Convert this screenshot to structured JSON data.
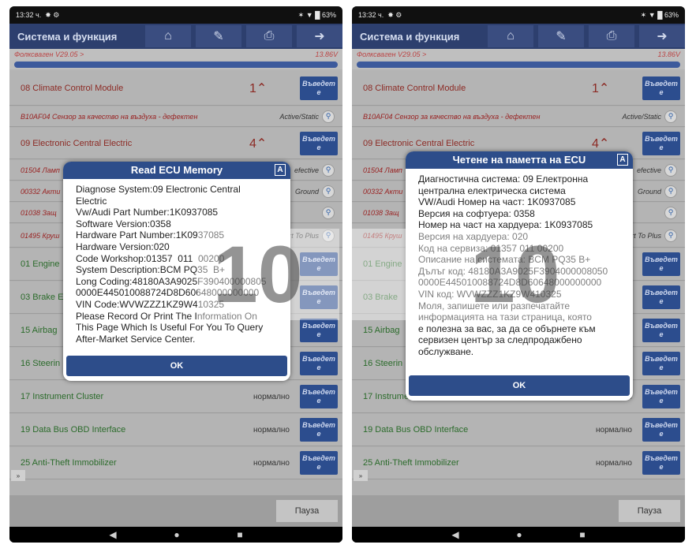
{
  "status_left": {
    "time": "13:32 ч.",
    "icons": "✸ ⚙"
  },
  "status_right": {
    "time": "13:32 ч.",
    "icons": "✸ ⚙"
  },
  "status_icons_right": "✶ ▼ █ 63%",
  "appbar": {
    "title": "Система и функция",
    "icons": [
      "home-icon",
      "edit-icon",
      "print-icon",
      "exit-icon"
    ]
  },
  "subbar": {
    "version": "Фолксваген V29.05 >",
    "voltage": "13.86V"
  },
  "rows": {
    "r1": {
      "name": "08 Climate Control Module",
      "count": "1",
      "button": "Въведет е"
    },
    "r2": {
      "name": "B10AF04 Сензор за качество на въздуха - дефектен",
      "status": "Active/Static"
    },
    "r3": {
      "name": "09 Electronic Central Electric",
      "count": "4",
      "button": "Въведет е"
    },
    "r4": {
      "name": "01504 Ламп",
      "status": "efective"
    },
    "r5": {
      "name": "00332 Акти",
      "status": "Ground"
    },
    "r6": {
      "name": "01038 Защ"
    },
    "r7": {
      "name": "01495 Круш",
      "status": "Short To Plus"
    },
    "r8": {
      "name": "01 Engine",
      "button": "Въведет е"
    },
    "r9": {
      "name": "03 Brake E",
      "button": "Въведет е"
    },
    "r10": {
      "name": "15 Airbag",
      "button": "Въведет е"
    },
    "r11": {
      "name": "16 Steerin",
      "button": "Въведет е"
    },
    "r12": {
      "name": "17 Instrument Cluster",
      "status": "нормално",
      "button": "Въведет е"
    },
    "r13": {
      "name": "19 Data Bus OBD Interface",
      "status": "нормално",
      "button": "Въведет е"
    },
    "r14": {
      "name": "25 Anti-Theft Immobilizer",
      "status": "нормално",
      "button": "Въведет е"
    }
  },
  "rows_right": {
    "r4": "01504 Ламп",
    "r5": "00332 Акти",
    "r6": "01038 Защ",
    "r7": "01495 Круш",
    "r8": "01 Engine",
    "r9": "03 Brake",
    "r10": "15 Airbag",
    "r11": "16 Steerin"
  },
  "pause_label": "Пауза",
  "side_handle": "»",
  "nav": {
    "back": "◀",
    "home": "●",
    "recent": "■"
  },
  "dialog_en": {
    "title": "Read ECU Memory",
    "zoom": "A",
    "lines": [
      "Diagnose System:09 Electronic Central",
      "Electric",
      "Vw/Audi Part Number:1K0937085",
      "Software Version:0358",
      "Hardware Part Number:1K0937085",
      "Hardware Version:020",
      "Code Workshop:01357  011  00200",
      "System Description:BCM PQ35  B+",
      "Long Coding:48180A3A9025F390400000805",
      "0000E445010088724D8D60648000000000",
      "VIN Code:WVWZZZ1KZ9W410325",
      "Please Record Or Print The Information On",
      "This Page Which Is Useful For You To Query",
      "After-Market Service Center."
    ],
    "ok": "OK"
  },
  "dialog_bg": {
    "title": "Четене на паметта на ECU",
    "zoom": "A",
    "lines": [
      "Диагностична система: 09 Електронна",
      "централна електрическа система",
      "VW/Audi Номер на част: 1K0937085",
      "Версия на софтуера: 0358",
      "Номер на част на хардуера: 1K0937085",
      "Версия на хардуера: 020",
      "Код на сервиза: 01357 011 00200",
      "Описание на системата: BCM PQ35 B+",
      "Дълъг код: 48180A3A9025F3904000008050",
      "0000E445010088724D8D60648000000000",
      "VIN код: WVWZZZ1KZ9W410325",
      "Моля, запишете или разпечатайте",
      "информацията на тази страница, която",
      "е полезна за вас, за да се обърнете към",
      "сервизен център за следпродажбено",
      "обслужване."
    ],
    "ok": "OK"
  },
  "watermark": {
    "left": "10",
    "right": "10"
  },
  "colors": {
    "appbar": "#2d3f6e",
    "dialog_header": "#2d4d8a",
    "enter_button": "#2c4d8e"
  }
}
